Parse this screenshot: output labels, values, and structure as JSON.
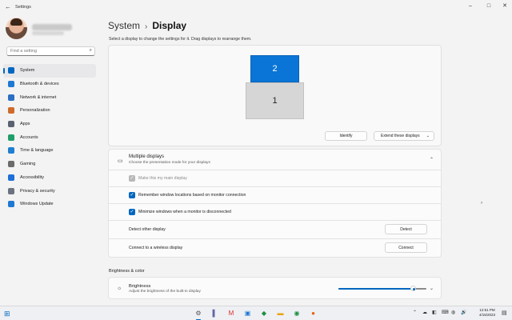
{
  "window": {
    "title": "Settings",
    "back_icon": "←",
    "minimize_icon": "–",
    "maximize_icon": "□",
    "close_icon": "✕"
  },
  "search": {
    "placeholder": "Find a setting",
    "icon": "⌕"
  },
  "sidebar": {
    "items": [
      {
        "label": "System",
        "icon": "display-icon",
        "color": "#0067c0",
        "active": true
      },
      {
        "label": "Bluetooth & devices",
        "icon": "bluetooth-icon",
        "color": "#1f78d1"
      },
      {
        "label": "Network & internet",
        "icon": "wifi-icon",
        "color": "#2b6fc4"
      },
      {
        "label": "Personalization",
        "icon": "brush-icon",
        "color": "#d06a2a"
      },
      {
        "label": "Apps",
        "icon": "apps-icon",
        "color": "#5a6272"
      },
      {
        "label": "Accounts",
        "icon": "person-icon",
        "color": "#1f9e6b"
      },
      {
        "label": "Time & language",
        "icon": "globe-clock-icon",
        "color": "#1f7fd1"
      },
      {
        "label": "Gaming",
        "icon": "controller-icon",
        "color": "#6b6b6b"
      },
      {
        "label": "Accessibility",
        "icon": "accessibility-icon",
        "color": "#1e6fd8"
      },
      {
        "label": "Privacy & security",
        "icon": "shield-icon",
        "color": "#6b7280"
      },
      {
        "label": "Windows Update",
        "icon": "update-icon",
        "color": "#1f78d1"
      }
    ]
  },
  "breadcrumb": {
    "parent": "System",
    "separator": "›",
    "current": "Display"
  },
  "instruction": "Select a display to change the settings for it. Drag displays to rearrange them.",
  "monitors": [
    {
      "label": "2",
      "selected": true
    },
    {
      "label": "1",
      "selected": false
    }
  ],
  "arrange_controls": {
    "identify_label": "Identify",
    "dropdown_value": "Extend these displays",
    "dropdown_icon": "chevron-down-icon"
  },
  "multiple_displays": {
    "title": "Multiple displays",
    "subtitle": "Choose the presentation mode for your displays",
    "chevron": "⌃",
    "options": [
      {
        "label": "Make this my main display",
        "checked": true,
        "disabled": true
      },
      {
        "label": "Remember window locations based on monitor connection",
        "checked": true,
        "disabled": false
      },
      {
        "label": "Minimize windows when a monitor is disconnected",
        "checked": true,
        "disabled": false
      }
    ],
    "detect": {
      "label": "Detect other display",
      "button": "Detect"
    },
    "connect": {
      "label": "Connect to a wireless display",
      "button": "Connect"
    }
  },
  "brightness_section": {
    "title": "Brightness & color",
    "brightness": {
      "title": "Brightness",
      "subtitle": "Adjust the brightness of the built-in display",
      "value_percent": 85,
      "chevron": "⌄"
    }
  },
  "taskbar": {
    "start_icon": "⊞",
    "apps": [
      {
        "name": "settings-app",
        "glyph": "⚙",
        "color": "#555",
        "active": true
      },
      {
        "name": "teams-app",
        "glyph": "▌",
        "color": "#6264a7"
      },
      {
        "name": "gmail-app",
        "glyph": "M",
        "color": "#d93025"
      },
      {
        "name": "photos-app",
        "glyph": "▣",
        "color": "#1f78d1"
      },
      {
        "name": "maps-app",
        "glyph": "◆",
        "color": "#1e8e3e"
      },
      {
        "name": "explorer-app",
        "glyph": "▬",
        "color": "#e8a200"
      },
      {
        "name": "chrome-app",
        "glyph": "◉",
        "color": "#1e8e3e"
      },
      {
        "name": "firefox-app",
        "glyph": "●",
        "color": "#e66000"
      }
    ],
    "tray": [
      "⌃",
      "☁",
      "◧",
      "⌨",
      "◍",
      "🔊"
    ],
    "time": "12:51 PM",
    "date": "4/15/2023",
    "notify_icon": "▤"
  }
}
